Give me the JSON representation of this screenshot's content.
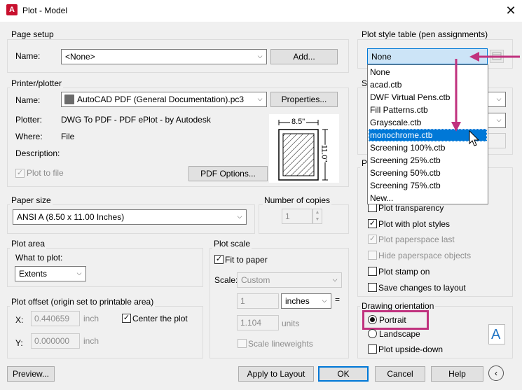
{
  "window": {
    "title": "Plot - Model",
    "app_icon_letter": "A"
  },
  "page_setup": {
    "group_label": "Page setup",
    "name_label": "Name:",
    "name_value": "<None>",
    "add_button": "Add..."
  },
  "printer": {
    "group_label": "Printer/plotter",
    "name_label": "Name:",
    "name_value": "AutoCAD PDF (General Documentation).pc3",
    "properties_button": "Properties...",
    "plotter_label": "Plotter:",
    "plotter_value": "DWG To PDF - PDF ePlot - by Autodesk",
    "where_label": "Where:",
    "where_value": "File",
    "description_label": "Description:",
    "plot_to_file_label": "Plot to file",
    "pdf_options_button": "PDF Options...",
    "preview_width_label": "8.5\"",
    "preview_height_label": "11.0\""
  },
  "paper_size": {
    "group_label": "Paper size",
    "value": "ANSI A (8.50 x 11.00 Inches)"
  },
  "copies": {
    "group_label": "Number of copies",
    "value": "1"
  },
  "plot_area": {
    "group_label": "Plot area",
    "what_label": "What to plot:",
    "value": "Extents"
  },
  "plot_offset": {
    "group_label": "Plot offset (origin set to printable area)",
    "x_label": "X:",
    "x_value": "0.440659",
    "x_unit": "inch",
    "y_label": "Y:",
    "y_value": "0.000000",
    "y_unit": "inch",
    "center_label": "Center the plot"
  },
  "plot_scale": {
    "group_label": "Plot scale",
    "fit_label": "Fit to paper",
    "scale_label": "Scale:",
    "scale_value": "Custom",
    "value1": "1",
    "unit1": "inches",
    "equals": "=",
    "value2": "1.104",
    "unit2": "units",
    "lineweights_label": "Scale lineweights"
  },
  "plot_style": {
    "group_label": "Plot style table (pen assignments)",
    "selected": "None",
    "items": [
      "None",
      "acad.ctb",
      "DWF Virtual Pens.ctb",
      "Fill Patterns.ctb",
      "Grayscale.ctb",
      "monochrome.ctb",
      "Screening 100%.ctb",
      "Screening 25%.ctb",
      "Screening 50%.ctb",
      "Screening 75%.ctb",
      "New..."
    ],
    "highlighted_index": 5,
    "shaded_label_partial": "Sh",
    "options_label_partial": "Pl"
  },
  "plot_options": {
    "transparency_label": "Plot transparency",
    "with_styles_label": "Plot with plot styles",
    "paperspace_last_label": "Plot paperspace last",
    "hide_label": "Hide paperspace objects",
    "stamp_label": "Plot stamp on",
    "save_label": "Save changes to layout"
  },
  "orientation": {
    "group_label": "Drawing orientation",
    "portrait_label": "Portrait",
    "landscape_label": "Landscape",
    "upside_down_label": "Plot upside-down",
    "icon_letter": "A"
  },
  "footer": {
    "preview_button": "Preview...",
    "apply_button": "Apply to Layout",
    "ok_button": "OK",
    "cancel_button": "Cancel",
    "help_button": "Help"
  },
  "colors": {
    "annotation": "#c0327e",
    "selection": "#0078d7"
  }
}
